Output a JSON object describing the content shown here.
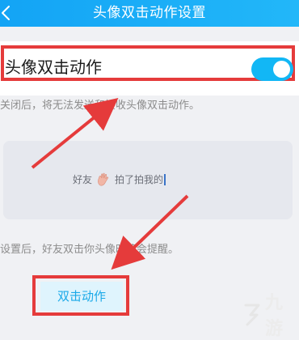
{
  "header": {
    "title": "头像双击动作设置",
    "back_icon": "chevron-left-icon"
  },
  "toggle": {
    "label": "头像双击动作",
    "state": "on",
    "accent": "#12b7f5"
  },
  "hints": {
    "disabled_hint": "关闭后，将无法发送和接收头像双击动作。",
    "settings_hint": "设置后，好友双击你头像时将会提醒。"
  },
  "preview": {
    "sender": "好友",
    "icon": "waving-hand-icon",
    "text": "拍了拍我的"
  },
  "action_button": {
    "label": "双击动作"
  },
  "watermark": {
    "text": "九游",
    "icon": "jiuyou-logo"
  },
  "colors": {
    "header_bg": "#13a4f5",
    "highlight": "#e53b3b",
    "button_bg": "#dff4fd",
    "button_text": "#1aa9e8"
  }
}
